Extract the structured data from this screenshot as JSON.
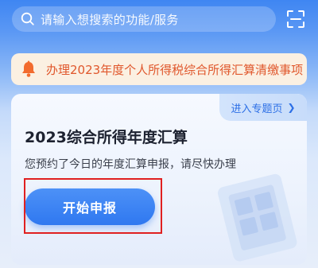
{
  "search": {
    "placeholder": "请输入想搜索的功能/服务",
    "search_icon": "search-icon",
    "scan_icon": "scan-icon"
  },
  "notice": {
    "icon": "bell-icon",
    "text": "办理2023年度个人所得税综合所得汇算清缴事项"
  },
  "card": {
    "topic_link": "进入专题页",
    "title": "2023综合所得年度汇算",
    "subtitle": "您预约了今日的年度汇算申报，请尽快办理",
    "start_button": "开始申报"
  },
  "colors": {
    "brand_blue": "#2f78f0",
    "notice_text": "#e0572c",
    "notice_bg": "#fbf0e2",
    "highlight_red": "#e02020"
  }
}
